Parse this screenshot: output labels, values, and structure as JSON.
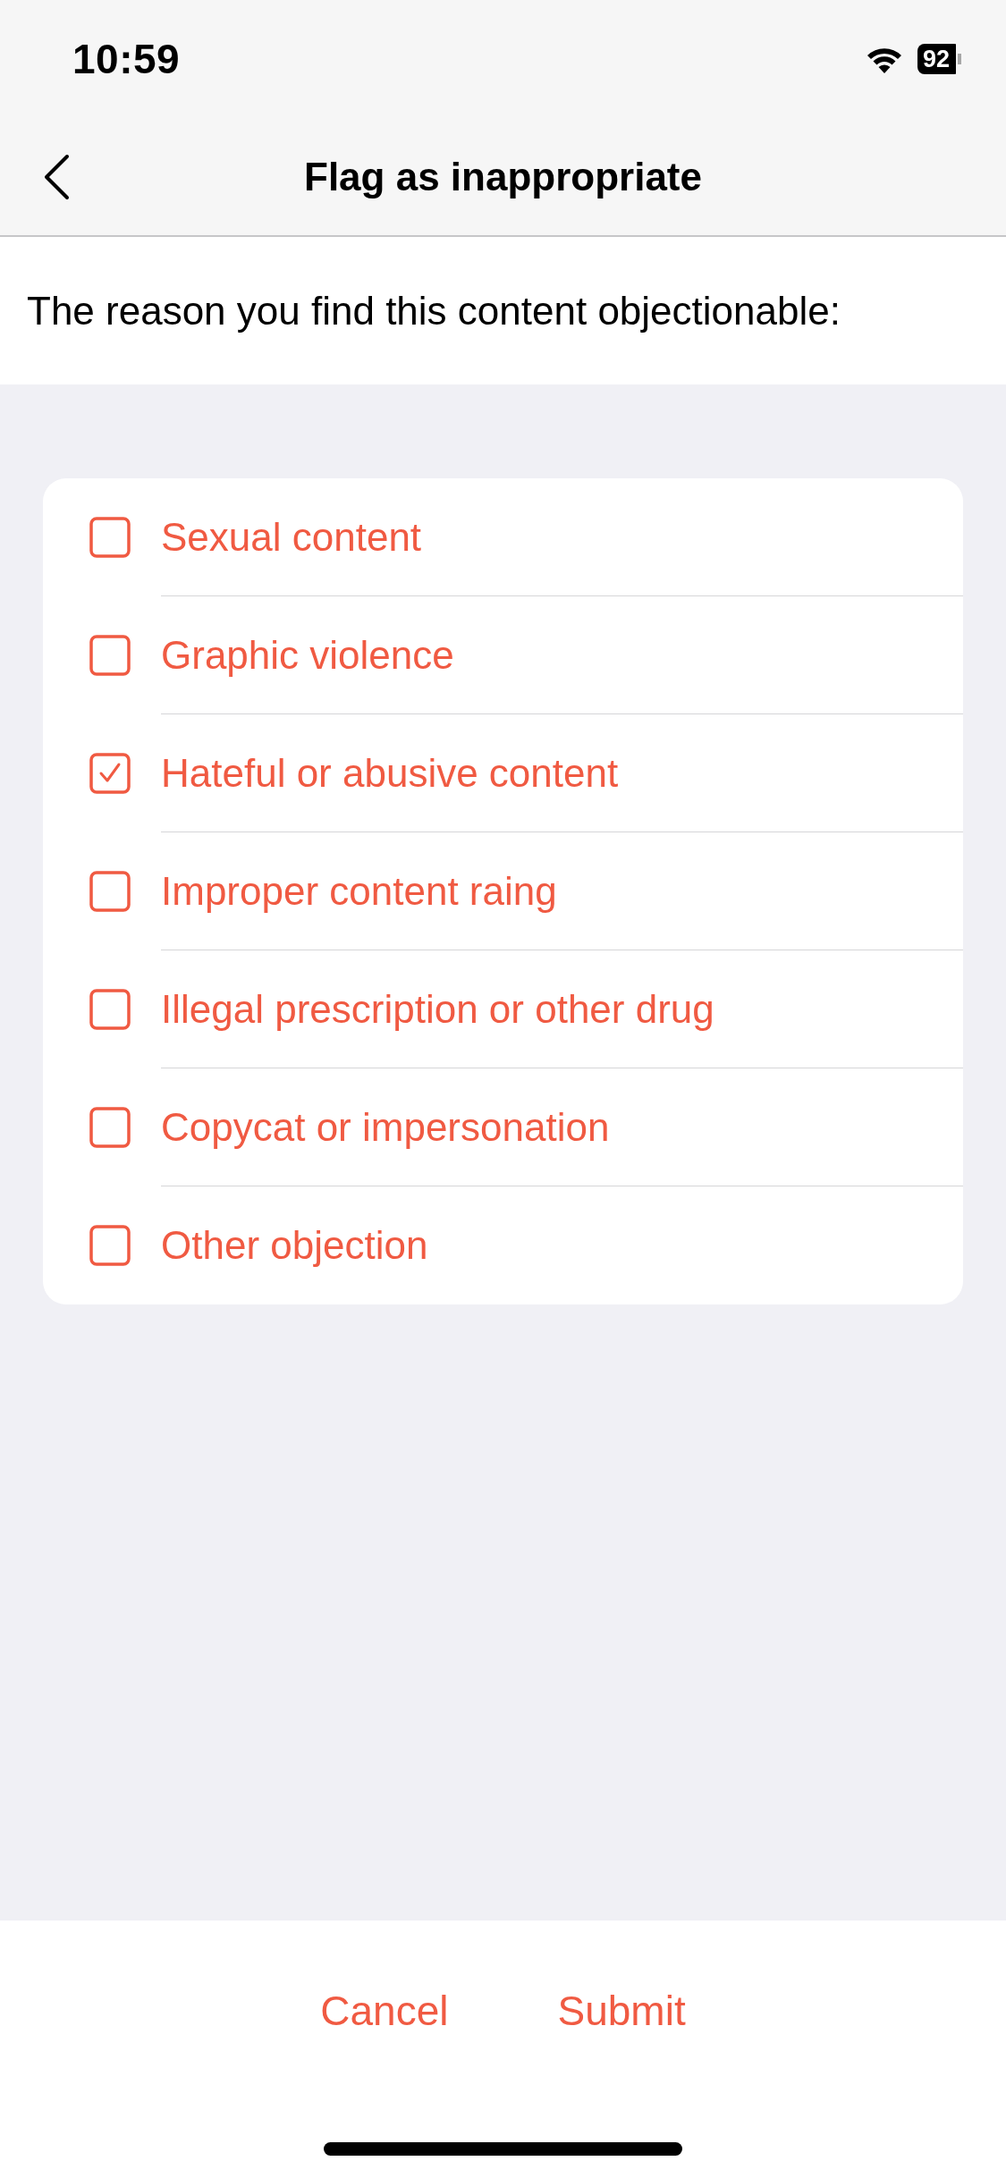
{
  "status_bar": {
    "time": "10:59",
    "battery": "92"
  },
  "nav_bar": {
    "title": "Flag as inappropriate"
  },
  "prompt": "The reason you find this content objectionable:",
  "reasons": [
    {
      "label": "Sexual content",
      "checked": false
    },
    {
      "label": "Graphic violence",
      "checked": false
    },
    {
      "label": "Hateful or abusive content",
      "checked": true
    },
    {
      "label": "Improper content raing",
      "checked": false
    },
    {
      "label": "Illegal prescription or other drug",
      "checked": false
    },
    {
      "label": "Copycat or impersonation",
      "checked": false
    },
    {
      "label": "Other objection",
      "checked": false
    }
  ],
  "buttons": [
    "Cancel",
    "Submit"
  ]
}
